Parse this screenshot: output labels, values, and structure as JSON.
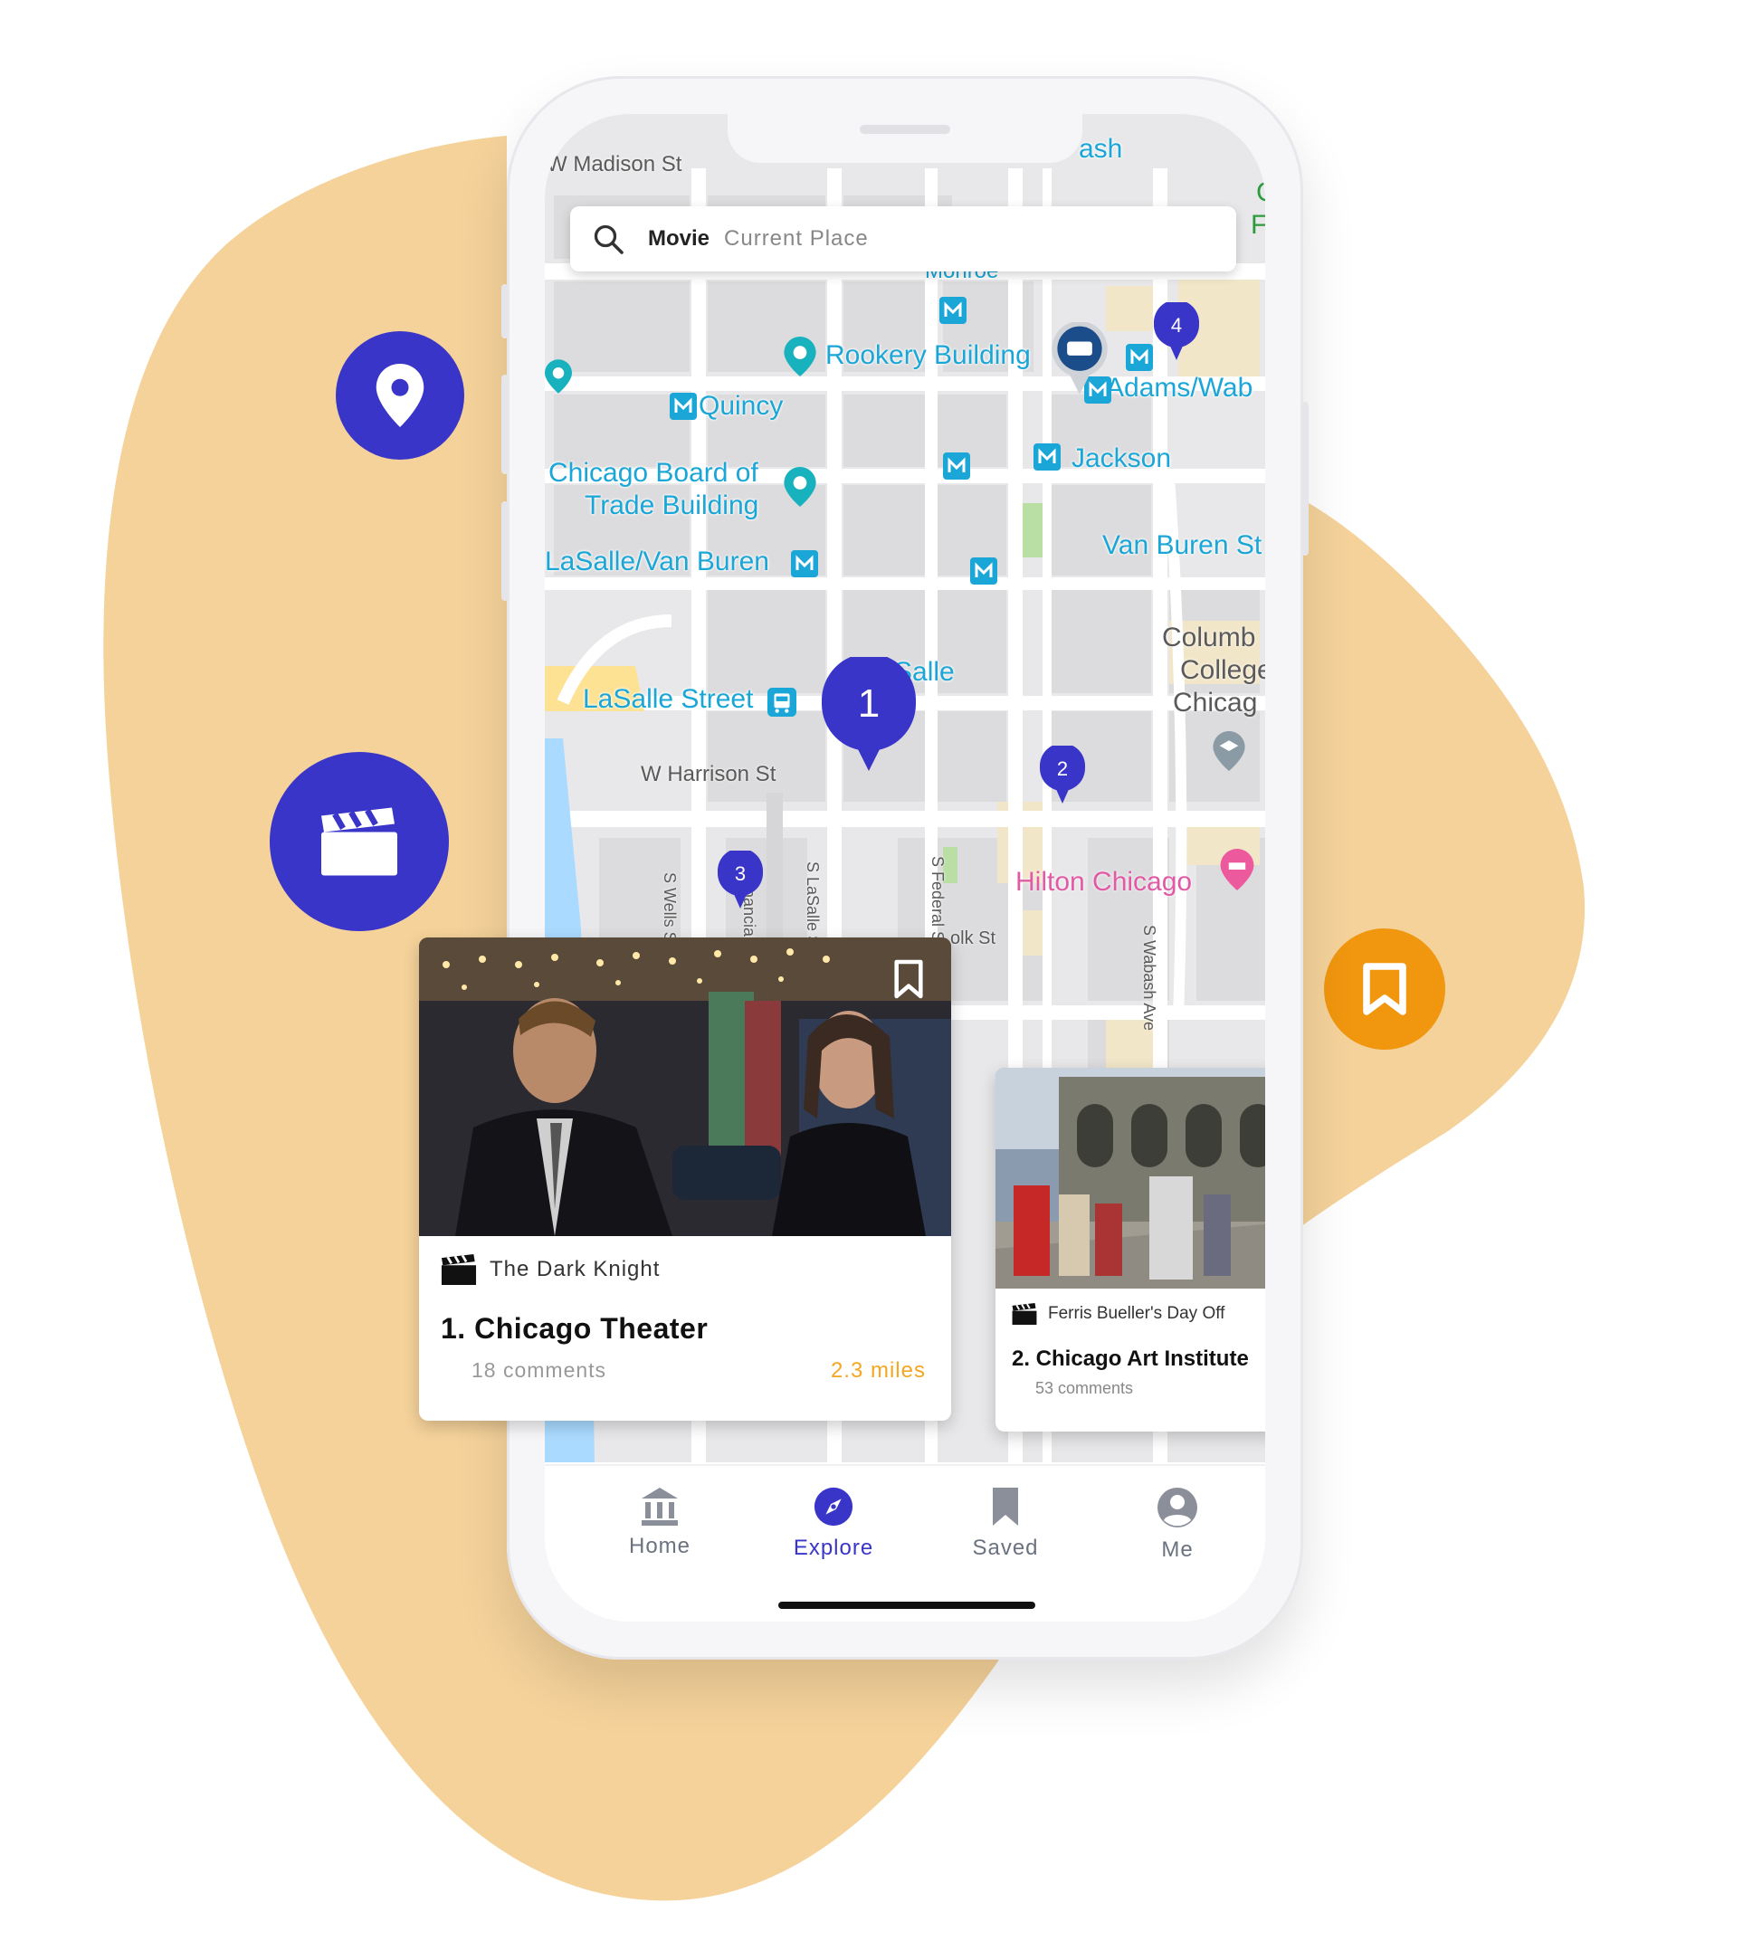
{
  "colors": {
    "accent": "#3a35c9",
    "orange": "#f0960f",
    "blob": "#f5d29a",
    "distance": "#f5a623"
  },
  "floating_icons": [
    {
      "icon": "location-pin-icon"
    },
    {
      "icon": "clapperboard-icon"
    },
    {
      "icon": "bookmark-icon"
    }
  ],
  "search": {
    "query": "Movie",
    "placeholder": "Current Place",
    "icon": "search-icon"
  },
  "map": {
    "streets": {
      "madison": "W Madison St",
      "harrison": "W Harrison St",
      "wells": "S Wells St",
      "financial": "S Financial Pl",
      "lasalle": "S LaSalle St",
      "federal": "S Federal St",
      "wabash": "S Wabash Ave",
      "polk": "olk St"
    },
    "places": {
      "rookery": "Rookery Building",
      "quincy": "Quincy",
      "cbot1": "Chicago Board of",
      "cbot2": "Trade Building",
      "lasalle_vb": "LaSalle/Van Buren",
      "jackson": "Jackson",
      "adams": "Adams/Wab",
      "vanburen": "Van Buren St",
      "columbia1": "Columb",
      "columbia2": "College",
      "columbia3": "Chicag",
      "lasalle_st": "LaSalle Street",
      "lasalle_cta": "Salle",
      "hilton": "Hilton Chicago",
      "top_right": "ash",
      "monroe": "Monroe",
      "cfo1": "C",
      "cfo2": "Fo"
    },
    "markers": [
      {
        "num": "1"
      },
      {
        "num": "2"
      },
      {
        "num": "3"
      },
      {
        "num": "4"
      }
    ]
  },
  "cards": [
    {
      "movie": "The Dark Knight",
      "title": "1. Chicago Theater",
      "comments": "18 comments",
      "distance": "2.3 miles",
      "bookmark_icon": "bookmark-outline-icon"
    },
    {
      "movie": "Ferris Bueller's Day Off",
      "title": "2. Chicago Art Institute",
      "comments": "53 comments"
    }
  ],
  "tabs": [
    {
      "label": "Home",
      "icon": "bank-icon",
      "active": false
    },
    {
      "label": "Explore",
      "icon": "compass-icon",
      "active": true
    },
    {
      "label": "Saved",
      "icon": "bookmark-icon",
      "active": false
    },
    {
      "label": "Me",
      "icon": "account-icon",
      "active": false
    }
  ]
}
